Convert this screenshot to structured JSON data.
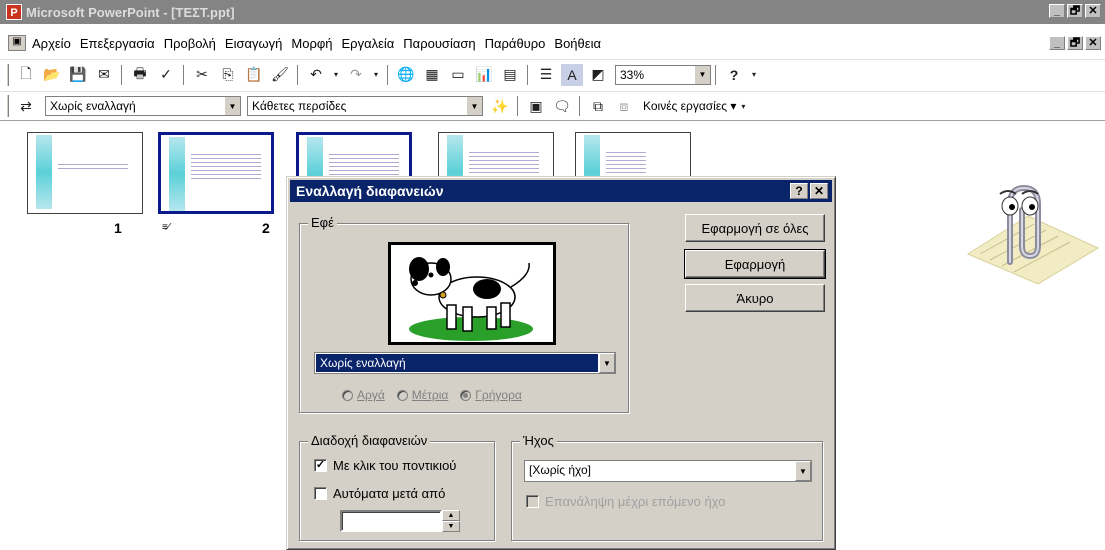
{
  "window": {
    "title": "Microsoft PowerPoint - [ΤΕΣΤ.ppt]",
    "controls": [
      "_",
      "🗗",
      "✕"
    ]
  },
  "menubar": {
    "items": [
      "Αρχείο",
      "Επεξεργασία",
      "Προβολή",
      "Εισαγωγή",
      "Μορφή",
      "Εργαλεία",
      "Παρουσίαση",
      "Παράθυρο",
      "Βοήθεια"
    ]
  },
  "toolbar1": {
    "zoom": "33%"
  },
  "toolbar2": {
    "transition_select": "Χωρίς εναλλαγή",
    "effect_select": "Κάθετες περσίδες",
    "common_tasks": "Κοινές εργασίες ▾"
  },
  "slides": [
    {
      "number": "1"
    },
    {
      "number": "2"
    }
  ],
  "dialog": {
    "title": "Εναλλαγή διαφανειών",
    "help_btn": "?",
    "close_btn": "✕",
    "effect_group": "Εφέ",
    "effect_select": "Χωρίς εναλλαγή",
    "speed": {
      "slow": "Αργά",
      "medium": "Μέτρια",
      "fast": "Γρήγορα"
    },
    "apply_all": "Εφαρμογή σε όλες",
    "apply": "Εφαρμογή",
    "cancel": "Άκυρο",
    "advance_group": "Διαδοχή διαφανειών",
    "on_click": "Με κλικ του ποντικιού",
    "auto_after": "Αυτόματα μετά από",
    "auto_value": "",
    "sound_group": "Ήχος",
    "sound_select": "[Χωρίς ήχο]",
    "loop_sound": "Επανάληψη μέχρι επόμενο ήχο"
  }
}
